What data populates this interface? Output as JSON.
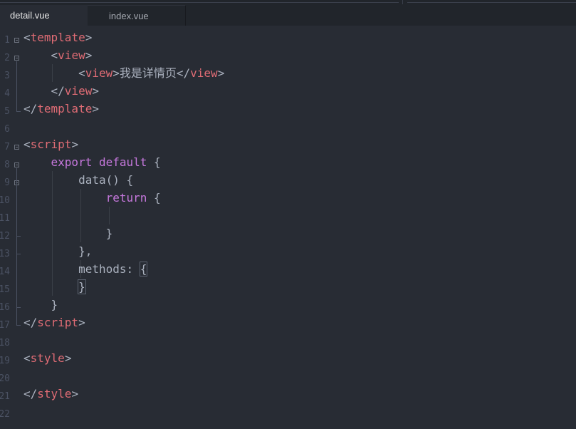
{
  "tabs": [
    {
      "label": "detail.vue",
      "active": true
    },
    {
      "label": "index.vue",
      "active": false
    }
  ],
  "editor": {
    "line_numbers": [
      "1",
      "2",
      "3",
      "4",
      "5",
      "6",
      "7",
      "8",
      "9",
      "10",
      "11",
      "12",
      "13",
      "14",
      "15",
      "16",
      "17",
      "18",
      "19",
      "20",
      "21",
      "22"
    ],
    "lines": [
      [
        {
          "t": "<",
          "c": "punc"
        },
        {
          "t": "template",
          "c": "tag"
        },
        {
          "t": ">",
          "c": "punc"
        }
      ],
      [
        {
          "t": "    <",
          "c": "punc"
        },
        {
          "t": "view",
          "c": "tag"
        },
        {
          "t": ">",
          "c": "punc"
        }
      ],
      [
        {
          "t": "        <",
          "c": "punc"
        },
        {
          "t": "view",
          "c": "tag"
        },
        {
          "t": ">",
          "c": "punc"
        },
        {
          "t": "我是详情页",
          "c": "cjk"
        },
        {
          "t": "</",
          "c": "punc"
        },
        {
          "t": "view",
          "c": "tag"
        },
        {
          "t": ">",
          "c": "punc"
        }
      ],
      [
        {
          "t": "    </",
          "c": "punc"
        },
        {
          "t": "view",
          "c": "tag"
        },
        {
          "t": ">",
          "c": "punc"
        }
      ],
      [
        {
          "t": "</",
          "c": "punc"
        },
        {
          "t": "template",
          "c": "tag"
        },
        {
          "t": ">",
          "c": "punc"
        }
      ],
      [],
      [
        {
          "t": "<",
          "c": "punc"
        },
        {
          "t": "script",
          "c": "tag"
        },
        {
          "t": ">",
          "c": "punc"
        }
      ],
      [
        {
          "t": "    ",
          "c": "punc"
        },
        {
          "t": "export",
          "c": "kw"
        },
        {
          "t": " ",
          "c": "punc"
        },
        {
          "t": "default",
          "c": "kw"
        },
        {
          "t": " {",
          "c": "punc"
        }
      ],
      [
        {
          "t": "        data() {",
          "c": "punc"
        }
      ],
      [
        {
          "t": "            ",
          "c": "punc"
        },
        {
          "t": "return",
          "c": "kw"
        },
        {
          "t": " {",
          "c": "punc"
        }
      ],
      [],
      [
        {
          "t": "            }",
          "c": "punc"
        }
      ],
      [
        {
          "t": "        },",
          "c": "punc"
        }
      ],
      [
        {
          "t": "        methods: ",
          "c": "punc"
        },
        {
          "t": "{",
          "c": "punc",
          "hl": true
        }
      ],
      [
        {
          "t": "        ",
          "c": "punc"
        },
        {
          "t": "}",
          "c": "punc",
          "hl": true
        }
      ],
      [
        {
          "t": "    }",
          "c": "punc"
        }
      ],
      [
        {
          "t": "</",
          "c": "punc"
        },
        {
          "t": "script",
          "c": "tag"
        },
        {
          "t": ">",
          "c": "punc"
        }
      ],
      [],
      [
        {
          "t": "<",
          "c": "punc"
        },
        {
          "t": "style",
          "c": "tag"
        },
        {
          "t": ">",
          "c": "punc"
        }
      ],
      [],
      [
        {
          "t": "</",
          "c": "punc"
        },
        {
          "t": "style",
          "c": "tag"
        },
        {
          "t": ">",
          "c": "punc"
        }
      ],
      []
    ]
  },
  "colors": {
    "background": "#282c34",
    "tag": "#e06c75",
    "keyword": "#c678dd",
    "text": "#abb2bf",
    "line_number": "#4b5263"
  }
}
